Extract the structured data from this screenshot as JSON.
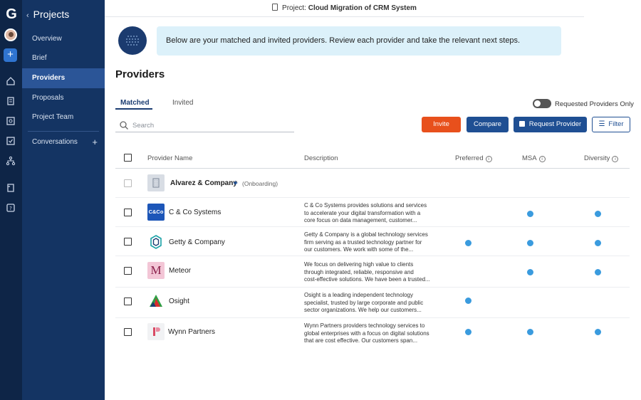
{
  "rail": {
    "logo": "G",
    "plus": "+"
  },
  "sidebar": {
    "title": "Projects",
    "items": [
      {
        "label": "Overview"
      },
      {
        "label": "Brief"
      },
      {
        "label": "Providers"
      },
      {
        "label": "Proposals"
      },
      {
        "label": "Project Team"
      }
    ],
    "conversations": "Conversations",
    "plus": "+"
  },
  "topbar": {
    "prefix": "Project:",
    "project_name": "Cloud Migration of CRM System"
  },
  "banner": {
    "text": "Below are your matched and invited providers. Review each provider and take the relevant next steps."
  },
  "page": {
    "title": "Providers"
  },
  "tabs": [
    {
      "label": "Matched"
    },
    {
      "label": "Invited"
    }
  ],
  "toggle": {
    "label": "Requested Providers Only"
  },
  "search": {
    "placeholder": "Search"
  },
  "buttons": {
    "invite": "Invite",
    "compare": "Compare",
    "request": "Request Provider",
    "filter": "Filter"
  },
  "table": {
    "headers": {
      "name": "Provider Name",
      "description": "Description",
      "preferred": "Preferred",
      "msa": "MSA",
      "diversity": "Diversity"
    },
    "rows": [
      {
        "name": "Alvarez & Company",
        "status": "(Onboarding)",
        "desc1": "",
        "desc2": "",
        "desc3": "",
        "preferred": false,
        "msa": false,
        "diversity": false
      },
      {
        "name": "C & Co Systems",
        "logo_text": "C&Co",
        "desc1": "C & Co Systems provides solutions and services",
        "desc2": "to accelerate your digital transformation with a",
        "desc3": "core focus on data management, customer...",
        "preferred": false,
        "msa": true,
        "diversity": true
      },
      {
        "name": "Getty & Company",
        "desc1": "Getty & Company is a global technology services",
        "desc2": "firm serving as a trusted technology partner for",
        "desc3": "our customers. We work with some of the...",
        "preferred": true,
        "msa": true,
        "diversity": true
      },
      {
        "name": "Meteor",
        "logo_text": "M",
        "desc1": "We focus on delivering high value to clients",
        "desc2": "through integrated, reliable, responsive and",
        "desc3": "cost-effective solutions. We have been a trusted...",
        "preferred": false,
        "msa": true,
        "diversity": true
      },
      {
        "name": "Osight",
        "desc1": "Osight is a leading independent technology",
        "desc2": "specialist, trusted by large corporate and public",
        "desc3": "sector organizations. We help our customers...",
        "preferred": true,
        "msa": false,
        "diversity": false
      },
      {
        "name": "Wynn Partners",
        "desc1": "Wynn Partners providers technology services to",
        "desc2": "global enterprises with a focus on digital solutions",
        "desc3": "that are cost effective.  Our customers span...",
        "preferred": true,
        "msa": true,
        "diversity": true
      }
    ]
  },
  "colors": {
    "rail": "#0e2547",
    "sidebar": "#143463",
    "sidebar_active": "#2b5597",
    "invite": "#e8501c",
    "primary": "#1f4f93",
    "banner": "#dcf1fa",
    "dot": "#3a9bde"
  }
}
